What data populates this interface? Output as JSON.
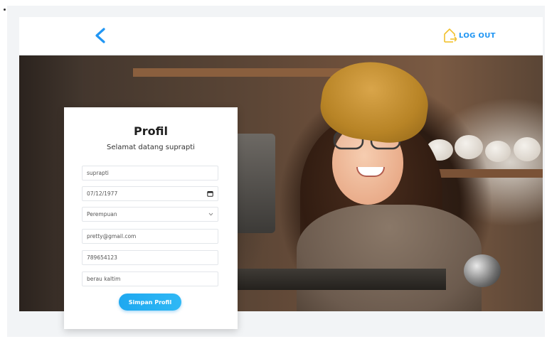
{
  "header": {
    "back_icon": "chevron-left-icon",
    "logout_icon": "house-logout-icon",
    "logout_label": "LOG OUT",
    "accent_color": "#2196f3"
  },
  "hero": {
    "image": "smiling woman with yellow beanie and glasses in coffee shop"
  },
  "profile_card": {
    "title": "Profil",
    "subtitle": "Selamat datang suprapti",
    "fields": {
      "name": "suprapti",
      "birthdate": "07/12/1977",
      "gender": "Perempuan",
      "email": "pretty@gmail.com",
      "phone": "789654123",
      "address": "berau kaltim"
    },
    "save_label": "Simpan Profil",
    "button_color": "#1ea8f0"
  }
}
